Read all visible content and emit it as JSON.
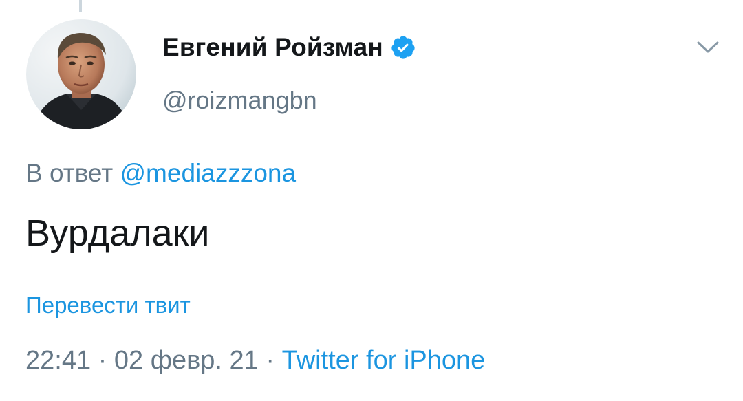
{
  "tweet": {
    "author": {
      "display_name": "Евгений Ройзман",
      "handle": "@roizmangbn",
      "verified": true
    },
    "reply_prefix": "В ответ",
    "reply_to": "@mediazzzona",
    "text": "Вурдалаки",
    "translate_label": "Перевести твит",
    "time": "22:41",
    "separator": "·",
    "date": "02 февр. 21",
    "source": "Twitter for iPhone"
  },
  "icons": {
    "verified": "verified-badge-icon",
    "menu": "chevron-down-icon"
  },
  "colors": {
    "text": "#14171a",
    "secondary": "#657786",
    "link": "#1b95e0",
    "verified": "#1da1f2",
    "thread_line": "#ccd6dd"
  }
}
